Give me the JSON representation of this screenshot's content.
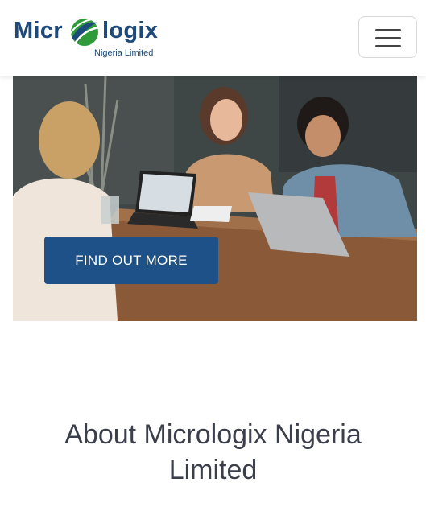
{
  "header": {
    "logo": {
      "word_left": "Micr",
      "word_right": "logix",
      "subtitle": "Nigeria Limited",
      "icon": "swoosh-globe-icon"
    },
    "menu_icon": "hamburger-menu-icon"
  },
  "hero": {
    "image": "three people working with laptops at a wooden table",
    "cta_label": "FIND OUT MORE"
  },
  "about": {
    "title": "About Micrologix Nigeria Limited"
  },
  "colors": {
    "brand_blue": "#1d4a7a",
    "brand_green": "#2e9a3a",
    "cta_blue": "#1d5187",
    "heading": "#3b3f4c"
  }
}
